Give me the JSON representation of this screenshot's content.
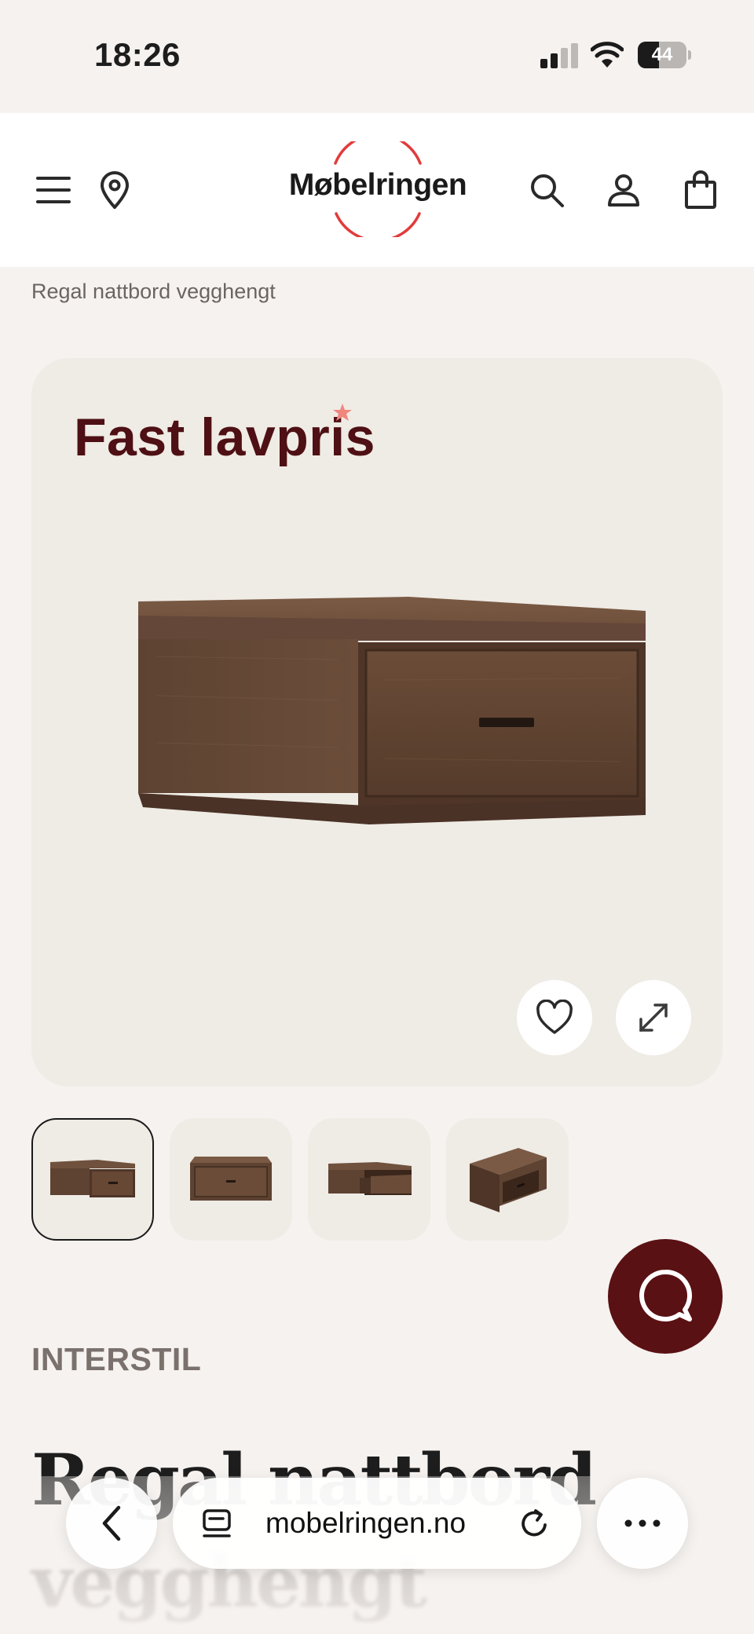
{
  "status_bar": {
    "time": "18:26",
    "battery_percent": "44",
    "battery_level": 0.44,
    "signal_bars_active": 2,
    "signal_bars_total": 4
  },
  "header": {
    "logo_text": "Møbelringen",
    "logo_ring_color": "#e23b3b",
    "icons": [
      "menu-icon",
      "location-pin-icon",
      "search-icon",
      "account-icon",
      "cart-icon"
    ]
  },
  "breadcrumb": "Regal nattbord vegghengt",
  "hero": {
    "promo_label": "Fast lavpris",
    "promo_color": "#4e1014",
    "favorite_icon": "heart-icon",
    "expand_icon": "expand-icon"
  },
  "thumbnails": {
    "count": 4,
    "active_index": 0
  },
  "chat": {
    "icon": "chat-bubble-icon",
    "color": "#5a1114"
  },
  "product": {
    "brand": "INTERSTIL",
    "title_line1": "Regal nattbord",
    "title_line2": "vegghengt"
  },
  "browser": {
    "url": "mobelringen.no",
    "back_icon": "chevron-left-icon",
    "tabs_icon": "page-menu-icon",
    "reload_icon": "reload-icon",
    "more_icon": "more-icon"
  }
}
